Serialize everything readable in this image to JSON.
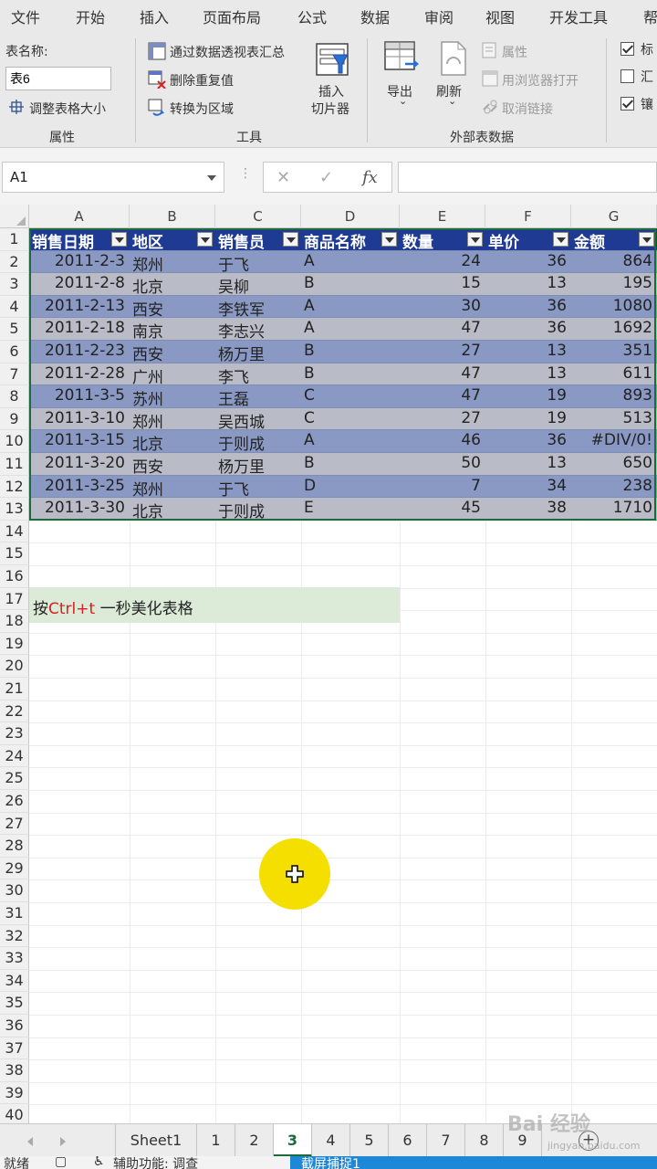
{
  "ribbon_tabs": [
    "文件",
    "开始",
    "插入",
    "页面布局",
    "公式",
    "数据",
    "审阅",
    "视图",
    "开发工具",
    "帮"
  ],
  "properties": {
    "table_name_label": "表名称:",
    "table_name_value": "表6",
    "resize_label": "调整表格大小",
    "group_label": "属性"
  },
  "tools": {
    "pivot_label": "通过数据透视表汇总",
    "remove_dup_label": "删除重复值",
    "convert_label": "转换为区域",
    "slicer_line1": "插入",
    "slicer_line2": "切片器",
    "group_label": "工具"
  },
  "external": {
    "export_label": "导出",
    "refresh_label": "刷新",
    "properties_label": "属性",
    "browser_label": "用浏览器打开",
    "unlink_label": "取消链接",
    "group_label": "外部表数据"
  },
  "style_options": [
    "标",
    "汇",
    "镶"
  ],
  "name_box": "A1",
  "columns": [
    "A",
    "B",
    "C",
    "D",
    "E",
    "F",
    "G"
  ],
  "row_numbers": [
    "1",
    "2",
    "3",
    "4",
    "5",
    "6",
    "7",
    "8",
    "9",
    "10",
    "11",
    "12",
    "13",
    "14",
    "15",
    "16",
    "17",
    "18",
    "19",
    "20",
    "21",
    "22",
    "23",
    "24",
    "25",
    "26",
    "27",
    "28",
    "29",
    "30",
    "31",
    "32",
    "33",
    "34",
    "35",
    "36",
    "37",
    "38",
    "39",
    "40"
  ],
  "table": {
    "headers": [
      "销售日期",
      "地区",
      "销售员",
      "商品名称",
      "数量",
      "单价",
      "金额"
    ],
    "rows": [
      [
        "2011-2-3",
        "郑州",
        "于飞",
        "A",
        "24",
        "36",
        "864"
      ],
      [
        "2011-2-8",
        "北京",
        "吴柳",
        "B",
        "15",
        "13",
        "195"
      ],
      [
        "2011-2-13",
        "西安",
        "李铁军",
        "A",
        "30",
        "36",
        "1080"
      ],
      [
        "2011-2-18",
        "南京",
        "李志兴",
        "A",
        "47",
        "36",
        "1692"
      ],
      [
        "2011-2-23",
        "西安",
        "杨万里",
        "B",
        "27",
        "13",
        "351"
      ],
      [
        "2011-2-28",
        "广州",
        "李飞",
        "B",
        "47",
        "13",
        "611"
      ],
      [
        "2011-3-5",
        "苏州",
        "王磊",
        "C",
        "47",
        "19",
        "893"
      ],
      [
        "2011-3-10",
        "郑州",
        "吴西城",
        "C",
        "27",
        "19",
        "513"
      ],
      [
        "2011-3-15",
        "北京",
        "于则成",
        "A",
        "46",
        "36",
        "#DIV/0!"
      ],
      [
        "2011-3-20",
        "西安",
        "杨万里",
        "B",
        "50",
        "13",
        "650"
      ],
      [
        "2011-3-25",
        "郑州",
        "于飞",
        "D",
        "7",
        "34",
        "238"
      ],
      [
        "2011-3-30",
        "北京",
        "于则成",
        "E",
        "45",
        "38",
        "1710"
      ]
    ]
  },
  "note": {
    "prefix": "按",
    "shortcut": "Ctrl+t",
    "suffix": " 一秒美化表格"
  },
  "sheet_tabs": [
    "Sheet1",
    "1",
    "2",
    "3",
    "4",
    "5",
    "6",
    "7",
    "8",
    "9"
  ],
  "active_sheet": "3",
  "status": {
    "ready": "就绪",
    "accessibility": "辅助功能: 调查",
    "capture": "截屏捕捉1"
  },
  "watermark": "Bai 经验",
  "watermark_url": "jingyan.baidu.com",
  "colors": {
    "header_bg": "#1f3a93",
    "band_dark": "#8a99c4",
    "band_light": "#b9bcc7",
    "accent_green": "#1d6b3a",
    "note_bg": "#dcebd8",
    "cursor_yellow": "#f4df00"
  }
}
